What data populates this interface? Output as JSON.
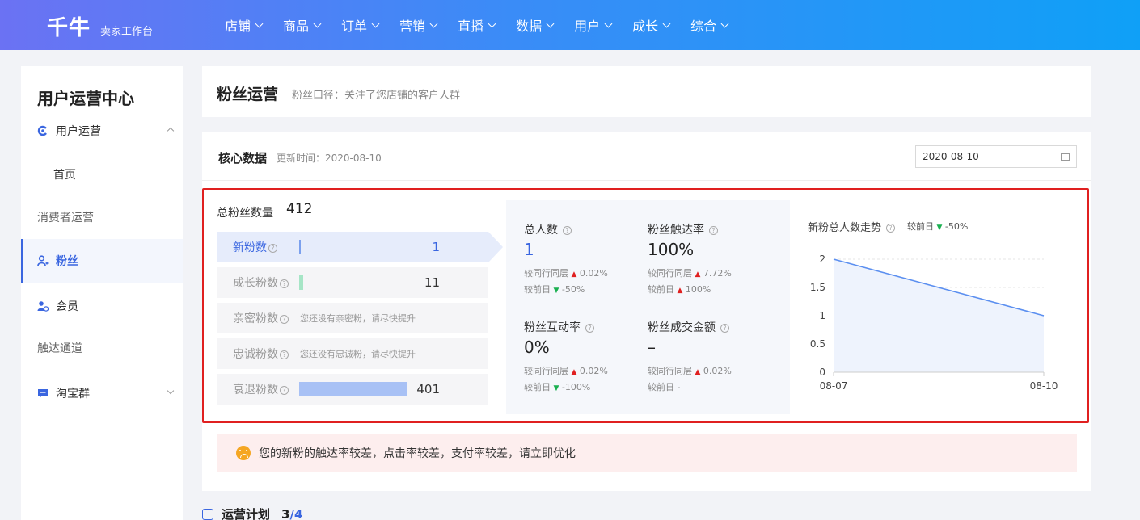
{
  "brand": {
    "logo": "千牛",
    "subtitle": "卖家工作台"
  },
  "nav": [
    {
      "label": "店铺"
    },
    {
      "label": "商品"
    },
    {
      "label": "订单"
    },
    {
      "label": "营销"
    },
    {
      "label": "直播"
    },
    {
      "label": "数据"
    },
    {
      "label": "用户"
    },
    {
      "label": "成长"
    },
    {
      "label": "综合"
    }
  ],
  "sidebar": {
    "title": "用户运营中心",
    "items": [
      {
        "label": "用户运营",
        "icon": "user-ops-icon"
      },
      {
        "label": "首页"
      },
      {
        "label": "消费者运营"
      },
      {
        "label": "粉丝",
        "icon": "fans-icon"
      },
      {
        "label": "会员",
        "icon": "member-icon"
      },
      {
        "label": "触达通道"
      },
      {
        "label": "淘宝群",
        "icon": "chat-icon"
      }
    ]
  },
  "header": {
    "title": "粉丝运营",
    "subtitle": "粉丝口径：关注了您店铺的客户人群"
  },
  "core": {
    "title": "核心数据",
    "update_time": "更新时间：2020-08-10",
    "date_value": "2020-08-10"
  },
  "fans": {
    "total_label": "总粉丝数量",
    "total_value": "412",
    "rows": [
      {
        "label": "新粉数",
        "value": "1",
        "bar_fraction": 0.0
      },
      {
        "label": "成长粉数",
        "value": "11",
        "bar_fraction": 0.03
      },
      {
        "label": "亲密粉数",
        "hint": "您还没有亲密粉，请尽快提升"
      },
      {
        "label": "忠诚粉数",
        "hint": "您还没有忠诚粉，请尽快提升"
      },
      {
        "label": "衰退粉数",
        "value": "401",
        "bar_fraction": 1.0
      }
    ]
  },
  "metrics": [
    {
      "label": "总人数",
      "value": "1",
      "peer": "较同行同层",
      "peer_val": "0.02%",
      "peer_dir": "up",
      "prev": "较前日",
      "prev_val": "-50%",
      "prev_dir": "down"
    },
    {
      "label": "粉丝触达率",
      "value": "100%",
      "peer": "较同行同层",
      "peer_val": "7.72%",
      "peer_dir": "up",
      "prev": "较前日",
      "prev_val": "100%",
      "prev_dir": "up"
    },
    {
      "label": "粉丝互动率",
      "value": "0%",
      "peer": "较同行同层",
      "peer_val": "0.02%",
      "peer_dir": "up",
      "prev": "较前日",
      "prev_val": "-100%",
      "prev_dir": "down"
    },
    {
      "label": "粉丝成交金额",
      "value": "–",
      "peer": "较同行同层",
      "peer_val": "0.02%",
      "peer_dir": "up",
      "prev": "较前日 -",
      "prev_val": "",
      "prev_dir": ""
    }
  ],
  "trend": {
    "title": "新粉总人数走势",
    "compare": "较前日",
    "compare_val": "-50%"
  },
  "chart_data": {
    "type": "area",
    "x": [
      "08-07",
      "08-10"
    ],
    "values": [
      2,
      1
    ],
    "yticks": [
      "2",
      "1.5",
      "1",
      "0.5",
      "0"
    ],
    "ylim": [
      0,
      2
    ],
    "line_color": "#5b8ff0",
    "fill_color": "#eef3fd"
  },
  "alert": {
    "text": "您的新粉的触达率较差，点击率较差，支付率较差，请立即优化"
  },
  "plan": {
    "title": "运营计划",
    "done": "3",
    "sep": "/",
    "total": "4"
  }
}
